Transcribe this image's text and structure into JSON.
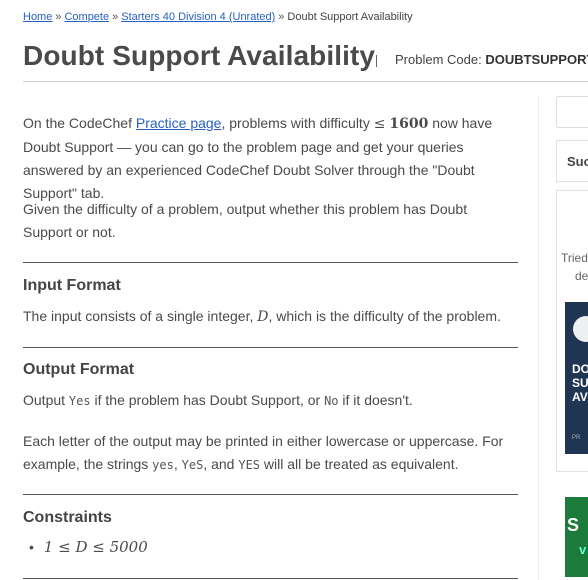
{
  "breadcrumb": {
    "items": [
      {
        "label": "Home",
        "link": true
      },
      {
        "label": "Compete",
        "link": true
      },
      {
        "label": "Starters 40 Division 4 (Unrated)",
        "link": true
      },
      {
        "label": "Doubt Support Availability",
        "link": false
      }
    ],
    "separator": "»"
  },
  "header": {
    "title": "Doubt Support Availability",
    "problem_code_label": "Problem Code:",
    "problem_code_value": "DOUBTSUPPORT"
  },
  "statement": {
    "p1_a": "On the CodeChef ",
    "p1_link": "Practice page",
    "p1_b": ", problems with difficulty ",
    "p1_leq": "≤",
    "p1_num": "1600",
    "p1_c": " now have Doubt Support — you can go to the problem page and get your queries answered by an experienced CodeChef Doubt Solver through the \"Doubt Support\" tab.",
    "p2": "Given the difficulty of a problem, output whether this problem has Doubt Support or not."
  },
  "input_format": {
    "heading": "Input Format",
    "text_a": "The input consists of a single integer, ",
    "var": "D",
    "text_b": ", which is the difficulty of the problem."
  },
  "output_format": {
    "heading": "Output Format",
    "t1": "Output ",
    "yes": "Yes",
    "t2": " if the problem has Doubt Support, or ",
    "no": "No",
    "t3": " if it doesn't.",
    "p2_a": "Each letter of the output may be printed in either lowercase or uppercase. For example, the strings ",
    "ex1": "yes",
    "c1": ", ",
    "ex2": "YeS",
    "c2": ", and ",
    "ex3": "YES",
    "p2_b": " will all be treated as equivalent."
  },
  "constraints": {
    "heading": "Constraints",
    "item": "1 ≤ D ≤ 5000"
  },
  "sidebar": {
    "fragment_heading": "Suc",
    "tried_line1": "Tried",
    "tried_line2": "de",
    "video_text_1": "DO",
    "video_text_2": "SU",
    "video_text_3": "AV",
    "video_small": "PR",
    "green_text_1": "S",
    "green_text_2": "v"
  },
  "colors": {
    "link": "#2860c0",
    "text": "#4a4a4a",
    "video_bg": "#1f3552",
    "promo_green": "#1c7a3a"
  }
}
